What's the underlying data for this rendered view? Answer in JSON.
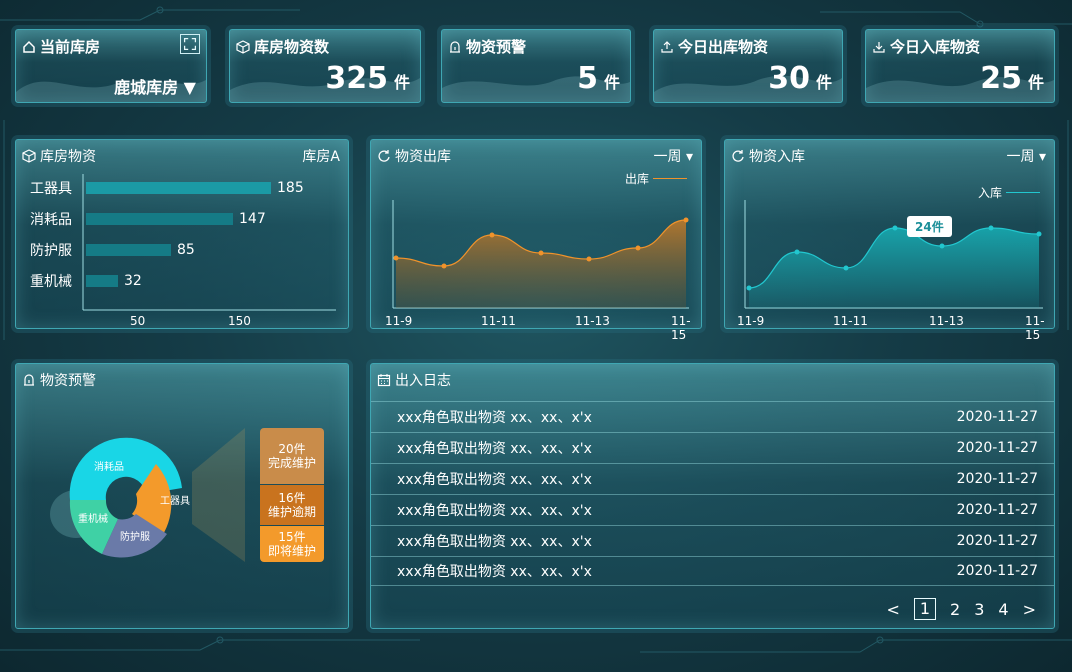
{
  "colors": {
    "accent": "#1b9aa5",
    "outbound": "#f0932b",
    "inbound": "#22c7cf",
    "consumable": "#19d6e6",
    "tools": "#f39a2b",
    "protective": "#6a7aa8",
    "heavy": "#3fd1a5"
  },
  "stats": {
    "warehouse": {
      "title": "当前库房",
      "value": "鹿城库房 ▼"
    },
    "materials": {
      "title": "库房物资数",
      "value": "325",
      "unit": "件"
    },
    "warning": {
      "title": "物资预警",
      "value": "5",
      "unit": "件"
    },
    "today_out": {
      "title": "今日出库物资",
      "value": "30",
      "unit": "件"
    },
    "today_in": {
      "title": "今日入库物资",
      "value": "25",
      "unit": "件"
    }
  },
  "inventory": {
    "title": "库房物资",
    "selector": "库房A",
    "items": [
      {
        "label": "工器具",
        "value": "185"
      },
      {
        "label": "消耗品",
        "value": "147"
      },
      {
        "label": "防护服",
        "value": "85"
      },
      {
        "label": "重机械",
        "value": "32"
      }
    ],
    "ticks": [
      "50",
      "150"
    ]
  },
  "outbound": {
    "title": "物资出库",
    "period": "一周 ▾",
    "legend": "出库",
    "x_labels": [
      "11-9",
      "11-11",
      "11-13",
      "11-15"
    ]
  },
  "inbound": {
    "title": "物资入库",
    "period": "一周 ▾",
    "legend": "入库",
    "tooltip": "24件",
    "x_labels": [
      "11-9",
      "11-11",
      "11-13",
      "11-15"
    ]
  },
  "warning_panel": {
    "title": "物资预警",
    "segments": [
      {
        "label": "消耗品"
      },
      {
        "label": "工器具"
      },
      {
        "label": "防护服"
      },
      {
        "label": "重机械"
      }
    ],
    "boxes": [
      {
        "count": "20件",
        "status": "完成维护"
      },
      {
        "count": "16件",
        "status": "维护逾期"
      },
      {
        "count": "15件",
        "status": "即将维护"
      }
    ]
  },
  "log": {
    "title": "出入日志",
    "rows": [
      {
        "text": "xxx角色取出物资 xx、xx、x'x",
        "date": "2020-11-27"
      },
      {
        "text": "xxx角色取出物资 xx、xx、x'x",
        "date": "2020-11-27"
      },
      {
        "text": "xxx角色取出物资 xx、xx、x'x",
        "date": "2020-11-27"
      },
      {
        "text": "xxx角色取出物资 xx、xx、x'x",
        "date": "2020-11-27"
      },
      {
        "text": "xxx角色取出物资 xx、xx、x'x",
        "date": "2020-11-27"
      },
      {
        "text": "xxx角色取出物资 xx、xx、x'x",
        "date": "2020-11-27"
      }
    ],
    "pagination": {
      "prev": "<",
      "pages": [
        "1",
        "2",
        "3",
        "4"
      ],
      "next": ">"
    }
  }
}
